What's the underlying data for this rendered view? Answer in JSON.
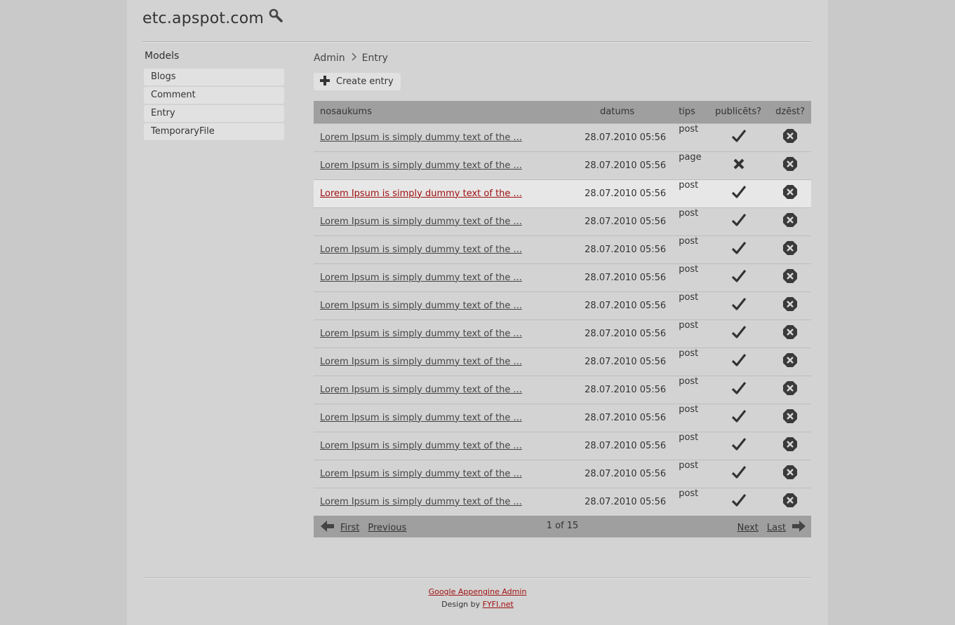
{
  "site": {
    "title": "etc.apspot.com"
  },
  "sidebar": {
    "heading": "Models",
    "items": [
      {
        "label": "Blogs"
      },
      {
        "label": "Comment"
      },
      {
        "label": "Entry"
      },
      {
        "label": "TemporaryFile"
      }
    ]
  },
  "breadcrumb": {
    "root": "Admin",
    "current": "Entry"
  },
  "toolbar": {
    "create_label": "Create entry"
  },
  "table": {
    "columns": [
      "nosaukums",
      "datums",
      "tips",
      "publicēts?",
      "dzēst?"
    ],
    "rows": [
      {
        "title": "Lorem Ipsum is simply dummy text of the ...",
        "date": "28.07.2010 05:56",
        "type": "post",
        "published": true
      },
      {
        "title": "Lorem Ipsum is simply dummy text of the ...",
        "date": "28.07.2010 05:56",
        "type": "page",
        "published": false
      },
      {
        "title": "Lorem Ipsum is simply dummy text of the ...",
        "date": "28.07.2010 05:56",
        "type": "post",
        "published": true,
        "highlighted": true
      },
      {
        "title": "Lorem Ipsum is simply dummy text of the ...",
        "date": "28.07.2010 05:56",
        "type": "post",
        "published": true
      },
      {
        "title": "Lorem Ipsum is simply dummy text of the ...",
        "date": "28.07.2010 05:56",
        "type": "post",
        "published": true
      },
      {
        "title": "Lorem Ipsum is simply dummy text of the ...",
        "date": "28.07.2010 05:56",
        "type": "post",
        "published": true
      },
      {
        "title": "Lorem Ipsum is simply dummy text of the ...",
        "date": "28.07.2010 05:56",
        "type": "post",
        "published": true
      },
      {
        "title": "Lorem Ipsum is simply dummy text of the ...",
        "date": "28.07.2010 05:56",
        "type": "post",
        "published": true
      },
      {
        "title": "Lorem Ipsum is simply dummy text of the ...",
        "date": "28.07.2010 05:56",
        "type": "post",
        "published": true
      },
      {
        "title": "Lorem Ipsum is simply dummy text of the ...",
        "date": "28.07.2010 05:56",
        "type": "post",
        "published": true
      },
      {
        "title": "Lorem Ipsum is simply dummy text of the ...",
        "date": "28.07.2010 05:56",
        "type": "post",
        "published": true
      },
      {
        "title": "Lorem Ipsum is simply dummy text of the ...",
        "date": "28.07.2010 05:56",
        "type": "post",
        "published": true
      },
      {
        "title": "Lorem Ipsum is simply dummy text of the ...",
        "date": "28.07.2010 05:56",
        "type": "post",
        "published": true
      },
      {
        "title": "Lorem Ipsum is simply dummy text of the ...",
        "date": "28.07.2010 05:56",
        "type": "post",
        "published": true
      }
    ]
  },
  "pager": {
    "first": "First",
    "previous": "Previous",
    "status": "1 of 15",
    "next": "Next",
    "last": "Last"
  },
  "footer": {
    "link_text": "Google Appengine Admin",
    "design_prefix": "Design by",
    "designer_link": "FYFI.net"
  },
  "colors": {
    "link_highlight": "#a01010",
    "header_bar": "#9f9f9f"
  }
}
